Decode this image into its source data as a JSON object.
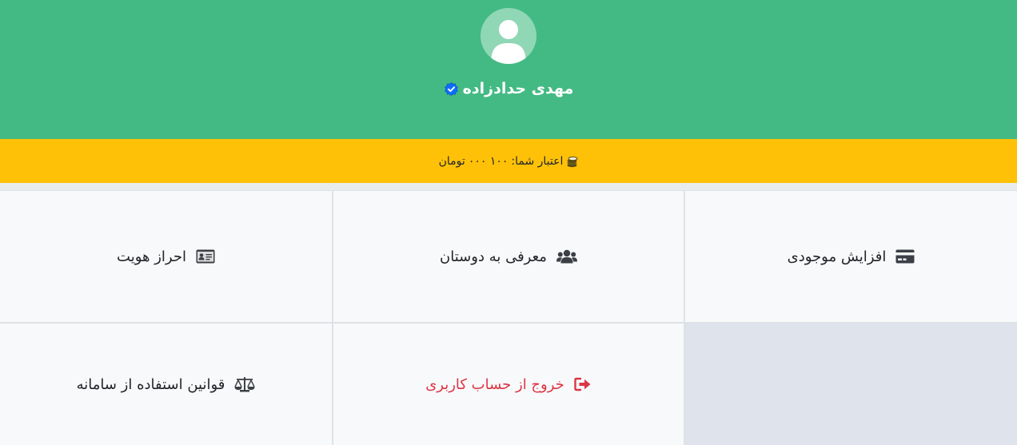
{
  "profile": {
    "name": "مهدی حدادزاده",
    "avatar_icon": "user-icon",
    "verified_icon": "verified-badge-icon"
  },
  "credit": {
    "icon": "coins-icon",
    "label": "اعتبار شما:",
    "amount": "۱۰۰ ۰۰۰",
    "currency": "تومان"
  },
  "menu": {
    "items": [
      {
        "label": "افزایش موجودی",
        "icon": "credit-card-icon"
      },
      {
        "label": "معرفی به دوستان",
        "icon": "users-icon"
      },
      {
        "label": "احراز هویت",
        "icon": "id-card-icon"
      },
      {
        "label": "قوانین استفاده از سامانه",
        "icon": "scale-icon"
      },
      {
        "label": "خروج از حساب کاربری",
        "icon": "sign-out-icon"
      }
    ]
  },
  "colors": {
    "header": "#43ba84",
    "credit_bar": "#ffc107",
    "tile": "#f8f9fa",
    "danger": "#dc3545",
    "empty_cell": "#dee3ec"
  }
}
